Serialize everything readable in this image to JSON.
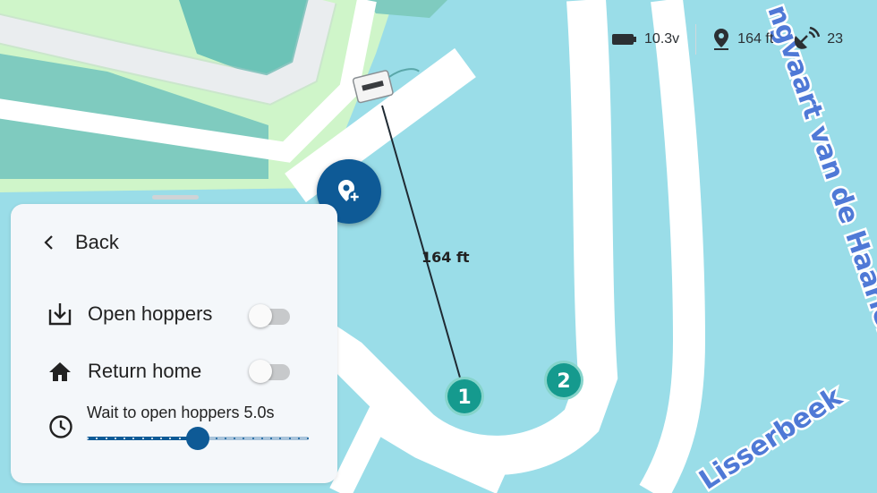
{
  "status_bar": {
    "battery_value": "10.3v",
    "distance_value": "164 ft",
    "satellites_value": "23",
    "battery_icon": "battery-icon",
    "location_icon": "location-pin-icon",
    "satellite_icon": "satellite-dish-icon"
  },
  "map": {
    "street_label_1": "ngvaart van de Haarlemmermee",
    "street_label_2": "Lisserbeek",
    "distance_label": "164 ft",
    "waypoints": [
      {
        "label": "1",
        "active": true
      },
      {
        "label": "2",
        "active": false
      }
    ],
    "device_icon": "boat-device-icon"
  },
  "fab": {
    "icon": "add-location-icon"
  },
  "panel": {
    "back_label": "Back",
    "options": [
      {
        "label": "Open hoppers",
        "icon": "download-tray-icon",
        "enabled": false
      },
      {
        "label": "Return home",
        "icon": "home-icon",
        "enabled": false
      }
    ],
    "wait": {
      "label": "Wait to open hoppers 5.0s",
      "icon": "clock-icon",
      "fraction": 0.5
    }
  },
  "colors": {
    "water": "#9adde8",
    "road": "#ffffff",
    "land": "#cff5c9",
    "building": "#7fcbbf",
    "primary": "#0e5a96",
    "waypoint": "#159a8e",
    "street_text": "#4f79d6"
  }
}
